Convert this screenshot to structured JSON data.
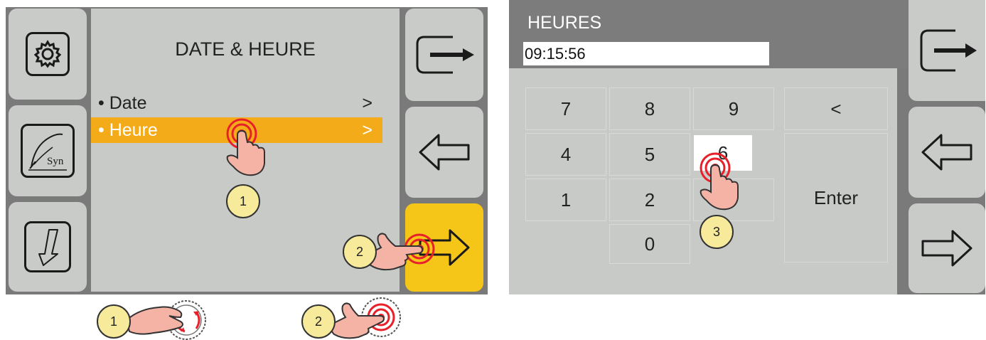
{
  "left_screen": {
    "title": "DATE & HEURE",
    "menu": [
      {
        "label": "• Date",
        "chevron": ">",
        "selected": false
      },
      {
        "label": "• Heure",
        "chevron": ">",
        "selected": true
      }
    ],
    "left_buttons": [
      {
        "icon": "gear-icon"
      },
      {
        "icon": "syn-signature-icon",
        "label": "Syn"
      },
      {
        "icon": "arrow-down-stroke-icon"
      }
    ],
    "right_buttons": [
      {
        "icon": "exit-icon"
      },
      {
        "icon": "arrow-left-icon"
      },
      {
        "icon": "arrow-right-icon",
        "active": true
      }
    ]
  },
  "right_screen": {
    "title": "HEURES",
    "time_value": "09:15:56",
    "keys": {
      "k7": "7",
      "k8": "8",
      "k9": "9",
      "back": "<",
      "k4": "4",
      "k5": "5",
      "k6": "6",
      "k1": "1",
      "k2": "2",
      "enter": "Enter",
      "k0": "0"
    },
    "pressed_key": "6",
    "right_buttons": [
      {
        "icon": "exit-icon"
      },
      {
        "icon": "arrow-left-icon"
      },
      {
        "icon": "arrow-right-icon"
      }
    ]
  },
  "steps": {
    "s1": "1",
    "s2": "2",
    "s3": "3",
    "b1": "1",
    "b2": "2"
  },
  "colors": {
    "selection": "#f4ab1a",
    "active_button": "#f5c518",
    "badge": "#f7ea9a",
    "hand": "#f5b3a6",
    "touch_ring": "#e8202a"
  }
}
